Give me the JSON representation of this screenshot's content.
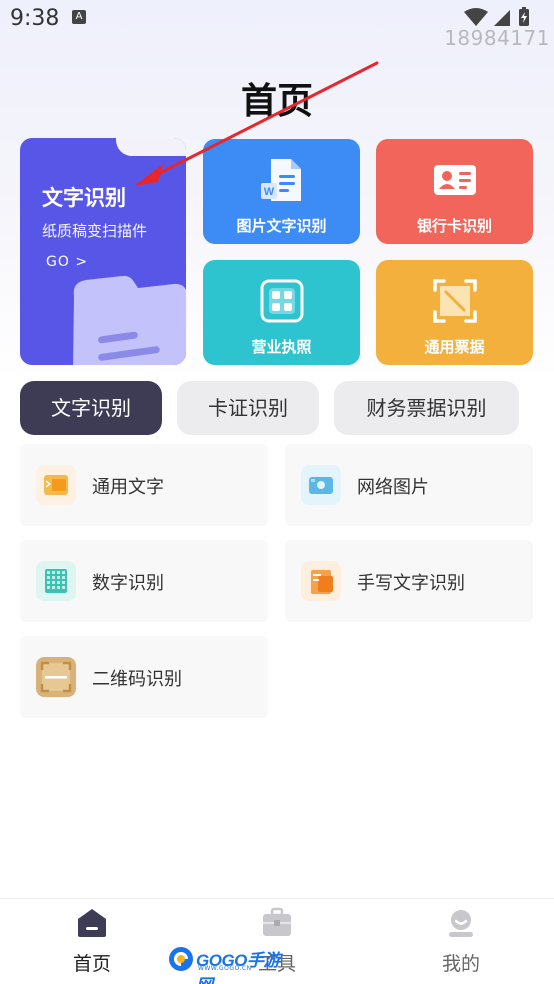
{
  "status_bar": {
    "time": "9:38",
    "notification_icon": "A",
    "overlay_number": "18984171"
  },
  "page": {
    "title": "首页"
  },
  "feature_cards": {
    "main": {
      "title": "文字识别",
      "subtitle": "纸质稿变扫描件",
      "go": "GO >"
    },
    "image_text": {
      "label": "图片文字识别",
      "icon": "word-document-icon",
      "color": "#3d8cf5"
    },
    "bank_card": {
      "label": "银行卡识别",
      "icon": "id-card-icon",
      "color": "#f2655a"
    },
    "business_license": {
      "label": "营业执照",
      "icon": "scan-frame-icon",
      "color": "#2dc3cf"
    },
    "general_receipt": {
      "label": "通用票据",
      "icon": "receipt-scan-icon",
      "color": "#f4b03d"
    }
  },
  "tabs": [
    {
      "label": "文字识别",
      "active": true
    },
    {
      "label": "卡证识别",
      "active": false
    },
    {
      "label": "财务票据识别",
      "active": false
    }
  ],
  "items": [
    {
      "label": "通用文字",
      "icon": "text-document-icon"
    },
    {
      "label": "网络图片",
      "icon": "web-image-icon"
    },
    {
      "label": "数字识别",
      "icon": "number-grid-icon"
    },
    {
      "label": "手写文字识别",
      "icon": "handwriting-icon"
    },
    {
      "label": "二维码识别",
      "icon": "qr-scan-icon"
    }
  ],
  "bottom_nav": [
    {
      "label": "首页",
      "icon": "home-icon",
      "active": true
    },
    {
      "label": "工具",
      "icon": "toolbox-icon",
      "active": false
    },
    {
      "label": "我的",
      "icon": "profile-icon",
      "active": false
    }
  ],
  "watermark": {
    "text": "GOGO手游网",
    "sub": "WWW.GOGO.CN"
  },
  "colors": {
    "main_card": "#5856e6",
    "tab_active": "#3e3c55",
    "annotation_arrow": "#e8262b"
  }
}
